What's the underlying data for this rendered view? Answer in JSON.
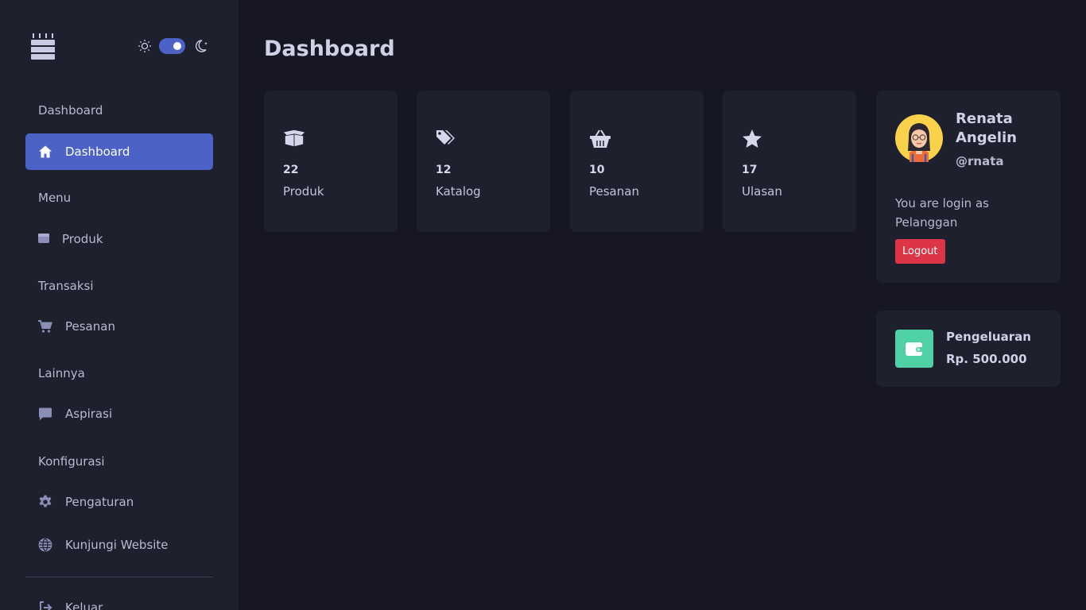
{
  "theme": {
    "accent": "#4c62c6",
    "danger": "#dc3545",
    "wallet": "#4fd1a5",
    "mode": "dark"
  },
  "sidebar": {
    "logo_icon": "birthday-cake-icon",
    "theme_toggle": {
      "light_icon": "sun-icon",
      "dark_icon": "moon-icon",
      "enabled": true
    },
    "sections": [
      {
        "heading": "Dashboard",
        "items": [
          {
            "label": "Dashboard",
            "icon": "home-icon",
            "active": true
          }
        ]
      },
      {
        "heading": "Menu",
        "items": [
          {
            "label": "Produk",
            "icon": "box-icon"
          }
        ]
      },
      {
        "heading": "Transaksi",
        "items": [
          {
            "label": "Pesanan",
            "icon": "cart-icon"
          }
        ]
      },
      {
        "heading": "Lainnya",
        "items": [
          {
            "label": "Aspirasi",
            "icon": "comment-icon"
          }
        ]
      },
      {
        "heading": "Konfigurasi",
        "items": [
          {
            "label": "Pengaturan",
            "icon": "gear-icon"
          },
          {
            "label": "Kunjungi Website",
            "icon": "globe-icon"
          }
        ]
      }
    ],
    "footer_item": {
      "label": "Keluar",
      "icon": "sign-out-icon"
    }
  },
  "main": {
    "title": "Dashboard",
    "stats": [
      {
        "value": "22",
        "label": "Produk",
        "icon": "open-box-icon"
      },
      {
        "value": "12",
        "label": "Katalog",
        "icon": "tags-icon"
      },
      {
        "value": "10",
        "label": "Pesanan",
        "icon": "basket-icon"
      },
      {
        "value": "17",
        "label": "Ulasan",
        "icon": "star-icon"
      }
    ]
  },
  "profile": {
    "name": "Renata Angelin",
    "handle": "@rnata",
    "login_text": "You are login as Pelanggan",
    "logout_label": "Logout"
  },
  "expense": {
    "label": "Pengeluaran",
    "amount": "Rp. 500.000",
    "icon": "wallet-icon"
  }
}
